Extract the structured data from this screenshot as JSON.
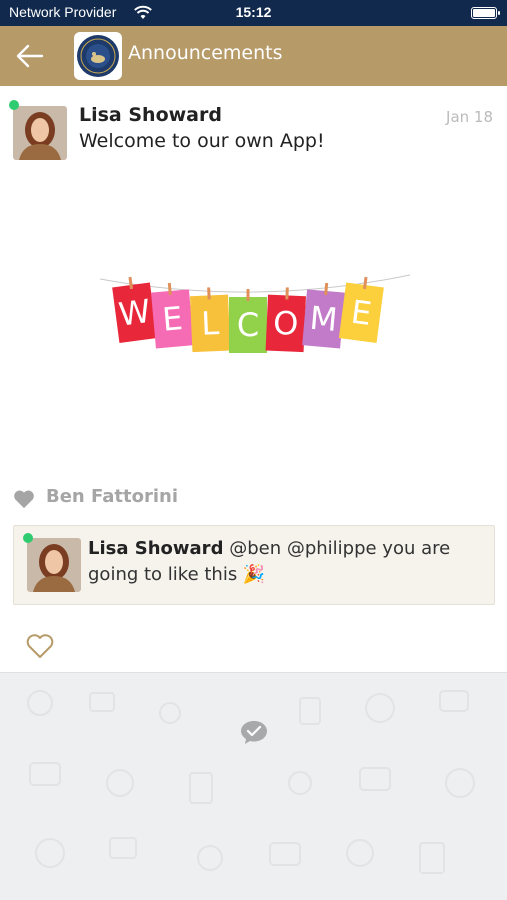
{
  "status_bar": {
    "carrier": "Network Provider",
    "time": "15:12"
  },
  "nav": {
    "title": "Announcements"
  },
  "post": {
    "author": "Lisa Showard",
    "date": "Jan 18",
    "text": "Welcome to our own App!",
    "image_letters": [
      "W",
      "E",
      "L",
      "C",
      "O",
      "M",
      "E"
    ],
    "image_colors": [
      "#e8283a",
      "#f56cb4",
      "#f8c13b",
      "#92d24a",
      "#e8283a",
      "#c27bc8",
      "#fbd03c"
    ]
  },
  "likes": {
    "liker": "Ben Fattorini"
  },
  "comment": {
    "author": "Lisa Showard",
    "text": "@ben @philippe you are going to like this 🎉"
  },
  "colors": {
    "status_bar": "#10294c",
    "nav_bar": "#b69a68",
    "online": "#2ecc71",
    "like_heart": "#b69a68"
  }
}
